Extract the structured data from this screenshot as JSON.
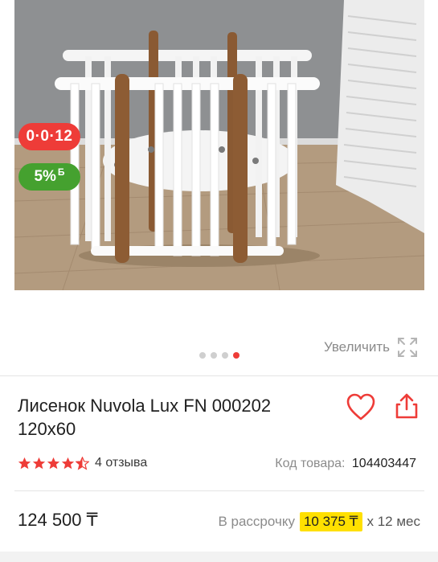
{
  "product": {
    "title": "Лисенок Nuvola Lux FN 000202 120x60",
    "rating_stars": 4.5,
    "reviews_text": "4 отзыва",
    "sku_label": "Код товара:",
    "sku_value": "104403447"
  },
  "badges": {
    "installment": "0·0·12",
    "bonus_percent": "5%",
    "bonus_unit": "Б"
  },
  "gallery": {
    "zoom_label": "Увеличить",
    "slide_count": 4,
    "active_slide": 4
  },
  "price": {
    "value": "124 500 ₸",
    "installment_label": "В рассрочку",
    "installment_amount": "10 375 ₸",
    "installment_term": "х 12 мес"
  },
  "colors": {
    "accent_red": "#ee3c38",
    "bonus_green": "#45a12f",
    "highlight_yellow": "#ffe000",
    "star_red": "#ee3c38"
  }
}
